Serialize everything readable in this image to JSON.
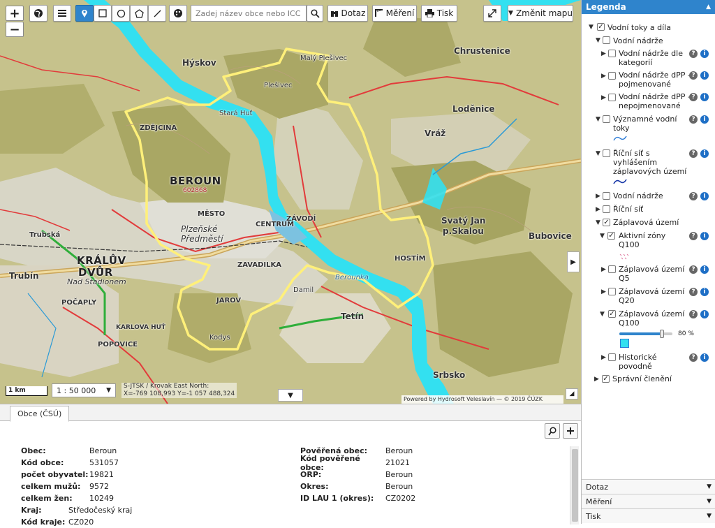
{
  "toolbar": {
    "search_placeholder": "Zadej název obce nebo ICC",
    "dotaz_label": "Dotaz",
    "mereni_label": "Měření",
    "tisk_label": "Tisk",
    "zmenit_mapu_label": "Změnit mapu"
  },
  "map": {
    "labels": {
      "beroun": "BEROUN",
      "beroun_code": "602868",
      "kraluv_dvur": "KRÁLŮV",
      "kraluv_dvur2": "DVŮR",
      "loden": "Loděnice",
      "chrustenice": "Chrustenice",
      "hyskov": "Hýskov",
      "vraz": "Vráž",
      "svaty_jan": "Svatý Jan",
      "pod_skalou": "p.Skalou",
      "bubovice": "Bubovice",
      "tetin": "Tetín",
      "srbsko": "Srbsko",
      "trubin": "Trubín",
      "trubska": "Trubská",
      "popovice": "POPOVICE",
      "zavodi": "ZÁVODÍ",
      "zavadilka": "ZAVADILKA",
      "mesto": "MĚSTO",
      "centrum": "CENTRUM",
      "plzenske": "Plzeňské",
      "predmesti": "Předměstí",
      "jarov": "JAROV",
      "zdejcina": "ZDĚJCINA",
      "hostim": "HOSTÍM",
      "nad_stadionem": "Nad Stadionem",
      "pocaply": "POČAPLY",
      "karlova_hut": "KARLOVA HUŤ",
      "berounka": "Berounka",
      "plesivec": "Plešivec",
      "maly_plesivec": "Malý Plešivec",
      "damil": "Damil",
      "kodys": "Kodys",
      "stara_hut": "Stará Huť"
    },
    "scale_label": "1 km",
    "scale_value": "1 : 50 000",
    "coords_line1": "S-JTSK / Krovak East North:",
    "coords_line2": "X=-769 108,993 Y=-1 057 488,324",
    "attribution": "Powered by Hydrosoft Veleslavín — © 2019 ČÚZK"
  },
  "bottom": {
    "tab_label": "Obce (ČSÚ)",
    "left_attrs": [
      {
        "k": "Obec:",
        "v": "Beroun"
      },
      {
        "k": "Kód obce:",
        "v": "531057"
      },
      {
        "k": "počet obyvatel:",
        "v": "19821"
      },
      {
        "k": "celkem mužů:",
        "v": "9572"
      },
      {
        "k": "celkem žen:",
        "v": "10249"
      },
      {
        "k": "Kraj:",
        "v": "Středočeský kraj"
      },
      {
        "k": "Kód kraje:",
        "v": "CZ020"
      }
    ],
    "right_attrs": [
      {
        "k": "Pověřená obec:",
        "v": "Beroun"
      },
      {
        "k": "Kód pověřené obce:",
        "v": "21021"
      },
      {
        "k": "ORP:",
        "v": "Beroun"
      },
      {
        "k": "Okres:",
        "v": "Beroun"
      },
      {
        "k": "ID LAU 1 (okres):",
        "v": "CZ0202"
      }
    ]
  },
  "legend": {
    "title": "Legenda",
    "items": {
      "vodni_toky": "Vodní toky a díla",
      "vodni_nadrze": "Vodní nádrže",
      "nadrze_kategorii_1": "Vodní nádrže dle",
      "nadrze_kategorii_2": "kategorií",
      "nadrze_dpp_poj_1": "Vodní nádrže dPP -",
      "nadrze_dpp_poj_2": "pojmenované",
      "nadrze_dpp_nepoj_1": "Vodní nádrže dPP -",
      "nadrze_dpp_nepoj_2": "nepojmenované",
      "vyznamne_1": "Významné vodní",
      "vyznamne_2": "toky",
      "ricni_sit_1": "Říční síť s",
      "ricni_sit_2": "vyhlášením",
      "ricni_sit_3": "záplavových území",
      "vodni_nadrze2": "Vodní nádrže",
      "ricni_sit": "Říční síť",
      "zaplavova": "Záplavová území",
      "aktivni_1": "Aktivní zóny",
      "aktivni_2": "Q100",
      "q5_1": "Záplavová území",
      "q5_2": "Q5",
      "q20_1": "Záplavová území",
      "q20_2": "Q20",
      "q100_1": "Záplavová území",
      "q100_2": "Q100",
      "opacity": "80 %",
      "historicke_1": "Historické",
      "historicke_2": "povodně",
      "spravni": "Správní členění"
    },
    "opacity_fraction": 0.8,
    "accordions": [
      "Dotaz",
      "Měření",
      "Tisk"
    ]
  },
  "colors": {
    "accent": "#2f84cc",
    "flood": "#33e0f0",
    "boundary": "#fff07a",
    "forest": "#a9a764"
  }
}
